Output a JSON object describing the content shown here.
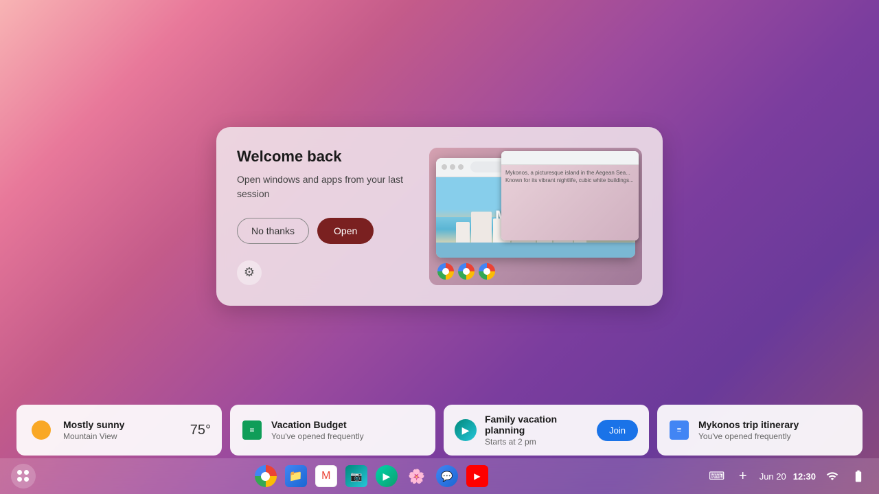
{
  "desktop": {
    "bg_description": "ChromeOS abstract pink-purple wallpaper"
  },
  "welcome_dialog": {
    "title": "Welcome back",
    "subtitle": "Open windows and apps from your last session",
    "btn_no_thanks": "No thanks",
    "btn_open": "Open",
    "preview_label": "Mykonos",
    "preview_text": "Mykonos"
  },
  "suggestions": [
    {
      "id": "weather",
      "title": "Mostly sunny",
      "subtitle": "Mountain View",
      "temp": "75°",
      "icon": "weather"
    },
    {
      "id": "vacation-budget",
      "title": "Vacation Budget",
      "subtitle": "You've opened frequently",
      "icon": "sheets"
    },
    {
      "id": "family-vacation",
      "title": "Family vacation planning",
      "subtitle": "Starts at 2 pm",
      "icon": "meet",
      "action": "Join"
    },
    {
      "id": "mykonos-itinerary",
      "title": "Mykonos trip itinerary",
      "subtitle": "You've opened frequently",
      "icon": "docs"
    }
  ],
  "taskbar": {
    "apps": [
      {
        "id": "chrome",
        "label": "Chrome"
      },
      {
        "id": "files",
        "label": "Files"
      },
      {
        "id": "gmail",
        "label": "Gmail"
      },
      {
        "id": "photos",
        "label": "Google Photos"
      },
      {
        "id": "play",
        "label": "Play"
      },
      {
        "id": "gphotos2",
        "label": "Photos"
      },
      {
        "id": "messages",
        "label": "Messages"
      },
      {
        "id": "youtube",
        "label": "YouTube"
      }
    ],
    "tray": {
      "keyboard": "⌨",
      "add": "+",
      "date": "Jun 20",
      "time": "12:30",
      "wifi": "wifi",
      "battery": "battery"
    }
  }
}
